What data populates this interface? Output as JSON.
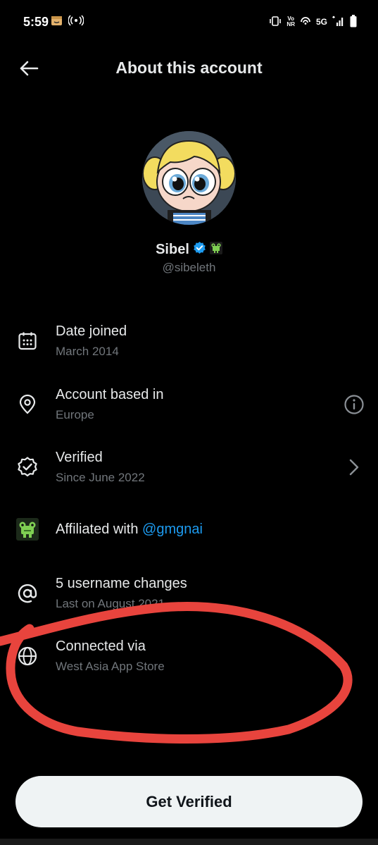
{
  "status_bar": {
    "time": "5:59",
    "network": "5G",
    "tiny_badge_top": "Vo",
    "tiny_badge_bottom": "NR"
  },
  "header": {
    "title": "About this account"
  },
  "profile": {
    "name": "Sibel",
    "handle": "@sibeleth"
  },
  "rows": {
    "date_joined": {
      "title": "Date joined",
      "value": "March 2014"
    },
    "account_based": {
      "title": "Account based in",
      "value": "Europe"
    },
    "verified": {
      "title": "Verified",
      "value": "Since June 2022"
    },
    "affiliated": {
      "title": "Affiliated with",
      "link": "@gmgnai"
    },
    "username_changes": {
      "title": "5 username changes",
      "value": "Last on August 2021"
    },
    "connected_via": {
      "title": "Connected via",
      "value": "West Asia App Store"
    }
  },
  "cta": {
    "label": "Get Verified"
  },
  "colors": {
    "background": "#000000",
    "text": "#e7e9ea",
    "muted": "#71767b",
    "link": "#1d9bf0",
    "annotation": "#e8443d",
    "button_bg": "#eff3f4"
  }
}
